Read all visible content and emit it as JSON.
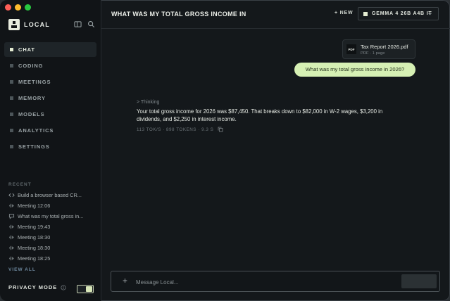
{
  "window": {
    "traffic_lights": [
      "close",
      "minimize",
      "maximize"
    ]
  },
  "sidebar": {
    "brand": "LOCAL",
    "nav": [
      {
        "label": "CHAT",
        "active": true
      },
      {
        "label": "CODING"
      },
      {
        "label": "MEETINGS"
      },
      {
        "label": "MEMORY"
      },
      {
        "label": "MODELS"
      },
      {
        "label": "ANALYTICS"
      },
      {
        "label": "SETTINGS"
      }
    ],
    "recent_label": "RECENT",
    "recent": [
      {
        "icon": "code-icon",
        "label": "Build a browser based CR..."
      },
      {
        "icon": "waveform-icon",
        "label": "Meeting 12:06"
      },
      {
        "icon": "chat-bubble-icon",
        "label": "What was my total gross in..."
      },
      {
        "icon": "waveform-icon",
        "label": "Meeting 19:43"
      },
      {
        "icon": "waveform-icon",
        "label": "Meeting 18:30"
      },
      {
        "icon": "waveform-icon",
        "label": "Meeting 18:30"
      },
      {
        "icon": "waveform-icon",
        "label": "Meeting 18:25"
      }
    ],
    "view_all": "VIEW ALL",
    "privacy_label": "PRIVACY MODE",
    "privacy_on": true
  },
  "header": {
    "title": "WHAT WAS MY TOTAL GROSS INCOME IN",
    "new_label": "+ NEW",
    "model": "GEMMA 4 26B A4B IT"
  },
  "conversation": {
    "attachment": {
      "badge": "PDF",
      "name": "Tax Report 2026.pdf",
      "meta": "PDF · 1 page"
    },
    "user_message": "What was my total gross income in 2026?",
    "thinking_label": "> Thinking",
    "answer": "Your total gross income for 2026 was $87,450. That breaks down to $82,000 in W-2 wages, $3,200 in dividends, and $2,250 in interest income.",
    "stats": "113 TOK/S · 898 TOKENS · 9.3 S"
  },
  "composer": {
    "placeholder": "Message Local...",
    "value": ""
  },
  "colors": {
    "accent": "#d6f0b4",
    "background": "#14181b",
    "sidebar": "#111417"
  }
}
